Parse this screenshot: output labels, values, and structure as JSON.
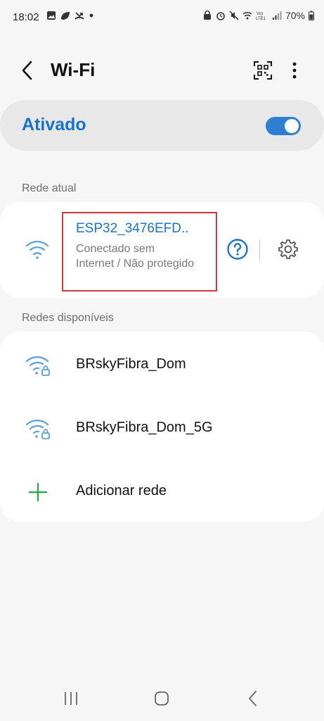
{
  "status_bar": {
    "time": "18:02",
    "left_icons": [
      "gallery-icon",
      "leaf-icon",
      "missed-call-icon",
      "dot-icon"
    ],
    "right_icons": [
      "alarm-lock-icon",
      "alarm-icon",
      "mute-icon",
      "wifi-icon",
      "volte-icon",
      "signal-icon"
    ],
    "volte_label": "Vo)\nLTE1",
    "battery_percent": "70%"
  },
  "app_bar": {
    "title": "Wi-Fi",
    "back_icon": "chevron-left-icon",
    "qr_icon": "qr-scan-icon",
    "more_icon": "more-vertical-icon"
  },
  "master_toggle": {
    "label": "Ativado",
    "enabled": true
  },
  "current_network": {
    "section_title": "Rede atual",
    "ssid": "ESP32_3476EFD..",
    "status": "Conectado sem Internet / Não protegido",
    "icon": "wifi-icon",
    "help_icon": "question-circle-icon",
    "settings_icon": "gear-icon"
  },
  "available_networks": {
    "section_title": "Redes disponíveis",
    "items": [
      {
        "label": "BRskyFibra_Dom",
        "icon": "wifi-lock-icon"
      },
      {
        "label": "BRskyFibra_Dom_5G",
        "icon": "wifi-lock-icon"
      },
      {
        "label": "Adicionar rede",
        "icon": "plus-icon"
      }
    ]
  },
  "nav_bar": {
    "items": [
      "recents-icon",
      "home-icon",
      "back-icon"
    ]
  },
  "colors": {
    "accent": "#1a73c9",
    "toggle_on": "#2d7fd1",
    "highlight_border": "#d0373b",
    "plus_green": "#2fa84f",
    "background": "#f6f6f6"
  }
}
